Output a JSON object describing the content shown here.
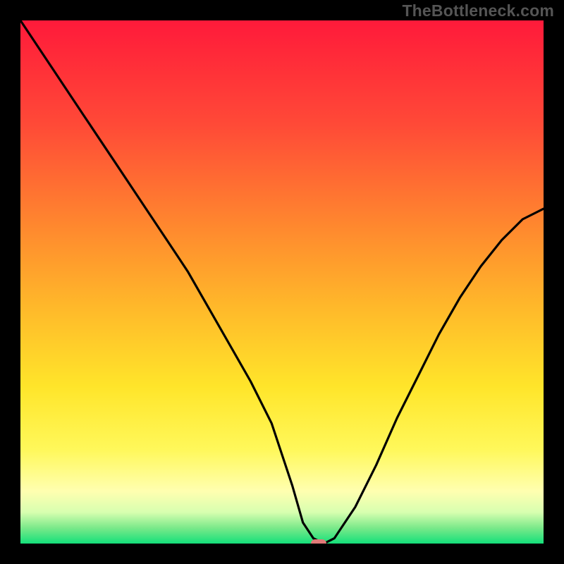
{
  "brand": "TheBottleneck.com",
  "colors": {
    "frame_bg": "#000000",
    "brand_text": "#555555",
    "marker": "#e17a78",
    "curve": "#000000",
    "gradient_stops": [
      {
        "pos": 0.0,
        "color": "#ff1a3a"
      },
      {
        "pos": 0.2,
        "color": "#ff4a37"
      },
      {
        "pos": 0.4,
        "color": "#ff8a2e"
      },
      {
        "pos": 0.55,
        "color": "#ffb92a"
      },
      {
        "pos": 0.7,
        "color": "#ffe52a"
      },
      {
        "pos": 0.82,
        "color": "#fff85a"
      },
      {
        "pos": 0.9,
        "color": "#ffffb0"
      },
      {
        "pos": 0.94,
        "color": "#d8ffb0"
      },
      {
        "pos": 0.97,
        "color": "#7be98a"
      },
      {
        "pos": 1.0,
        "color": "#14e07a"
      }
    ]
  },
  "chart_data": {
    "type": "line",
    "title": "",
    "xlabel": "",
    "ylabel": "",
    "xlim": [
      0,
      100
    ],
    "ylim": [
      0,
      100
    ],
    "series": [
      {
        "name": "bottleneck-curve",
        "x": [
          0,
          6,
          12,
          18,
          24,
          28,
          32,
          36,
          40,
          44,
          48,
          52,
          54,
          56,
          58,
          60,
          64,
          68,
          72,
          76,
          80,
          84,
          88,
          92,
          96,
          100
        ],
        "y": [
          100,
          91,
          82,
          73,
          64,
          58,
          52,
          45,
          38,
          31,
          23,
          11,
          4,
          1,
          0,
          1,
          7,
          15,
          24,
          32,
          40,
          47,
          53,
          58,
          62,
          64
        ]
      }
    ],
    "marker": {
      "x": 57,
      "y": 0
    },
    "background": "vertical-gradient red→yellow→green"
  }
}
